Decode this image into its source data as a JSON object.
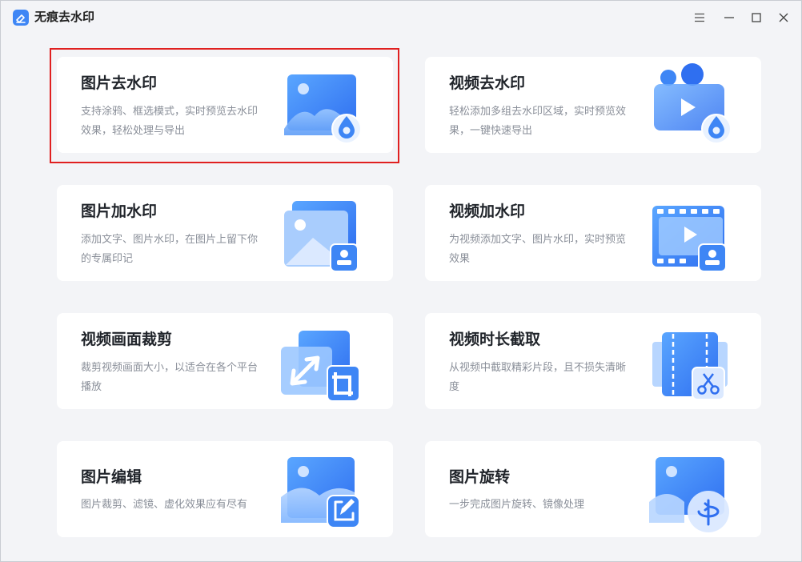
{
  "app": {
    "title": "无痕去水印"
  },
  "window_controls": {
    "menu_icon": "hamburger-icon",
    "minimize_icon": "minimize-icon",
    "maximize_icon": "maximize-icon",
    "close_icon": "close-icon"
  },
  "colors": {
    "accent": "#3e86f5",
    "accent_light": "#7fb5ff",
    "highlight": "#e02020"
  },
  "cards": [
    {
      "title": "图片去水印",
      "desc": "支持涂鸦、框选模式，实时预览去水印效果，轻松处理与导出"
    },
    {
      "title": "视频去水印",
      "desc": "轻松添加多组去水印区域，实时预览效果，一键快速导出"
    },
    {
      "title": "图片加水印",
      "desc": "添加文字、图片水印，在图片上留下你的专属印记"
    },
    {
      "title": "视频加水印",
      "desc": "为视频添加文字、图片水印，实时预览效果"
    },
    {
      "title": "视频画面裁剪",
      "desc": "裁剪视频画面大小，以适合在各个平台播放"
    },
    {
      "title": "视频时长截取",
      "desc": "从视频中截取精彩片段，且不损失清晰度"
    },
    {
      "title": "图片编辑",
      "desc": "图片裁剪、滤镜、虚化效果应有尽有"
    },
    {
      "title": "图片旋转",
      "desc": "一步完成图片旋转、镜像处理"
    }
  ]
}
